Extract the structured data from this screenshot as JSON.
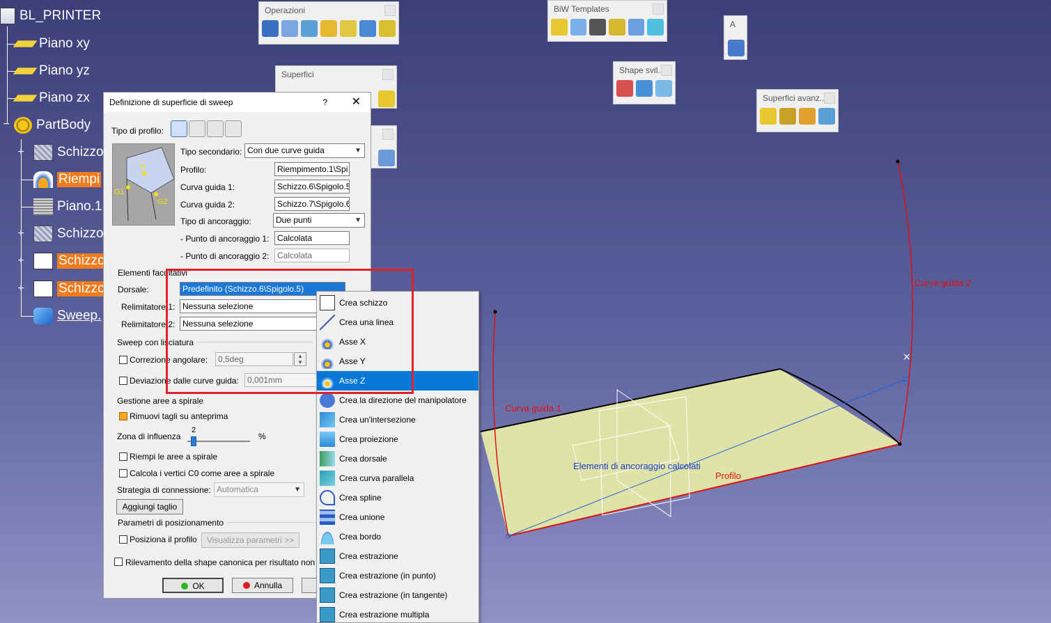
{
  "tree": {
    "root": "BL_PRINTER",
    "items": [
      {
        "label": "Piano xy"
      },
      {
        "label": "Piano yz"
      },
      {
        "label": "Piano zx"
      },
      {
        "label": "PartBody"
      },
      {
        "label": "Schizzo"
      },
      {
        "label": "Riempi"
      },
      {
        "label": "Piano.1"
      },
      {
        "label": "Schizzo"
      },
      {
        "label": "Schizzo"
      },
      {
        "label": "Schizzo"
      },
      {
        "label": "Sweep."
      }
    ]
  },
  "toolbars": {
    "operazioni": "Operazioni",
    "superfici": "Superfici",
    "biw": "BiW Templates",
    "shape": "Shape svil...",
    "avanzate": "Superfici avanz...",
    "small": "A"
  },
  "dialog": {
    "title": "Definizione di superficie di sweep",
    "help": "?",
    "tipo_profilo_label": "Tipo di profilo:",
    "tipo_secondario_label": "Tipo secondario:",
    "tipo_secondario_value": "Con due curve guida",
    "profilo_label": "Profilo:",
    "profilo_value": "Riempimento.1\\Spi",
    "guida1_label": "Curva guida 1:",
    "guida1_value": "Schizzo.6\\Spigolo.5",
    "guida2_label": "Curva guida 2:",
    "guida2_value": "Schizzo.7\\Spigolo.6",
    "ancoraggio_label": "Tipo di ancoraggio:",
    "ancoraggio_value": "Due punti",
    "punto1_label": "- Punto di ancoraggio 1:",
    "punto1_value": "Calcolata",
    "punto2_label": "- Punto di ancoraggio 2:",
    "punto2_value": "Calcolata",
    "preview_p": "P",
    "preview_g1": "G1",
    "preview_g2": "G2",
    "elementi_label": "Elementi facoltativi",
    "dorsale_label": "Dorsale:",
    "dorsale_value": "Predefinito (Schizzo.6\\Spigolo.5)",
    "rel1_label": "Relimitatore 1:",
    "rel1_value": "Nessuna selezione",
    "rel2_label": "Relimitatore 2:",
    "rel2_value": "Nessuna selezione",
    "sweep_lisc_label": "Sweep con lisciatura",
    "corr_ang_label": "Correzione angolare:",
    "corr_ang_value": "0,5deg",
    "dev_label": "Deviazione dalle curve guida:",
    "dev_value": "0,001mm",
    "spirale_label": "Gestione aree a spirale",
    "rimuovi_label": "Rimuovi tagli su anteprima",
    "zona_label": "Zona di influenza",
    "zona_value": "2",
    "zona_unit": "%",
    "riempi_label": "Riempi le aree a spirale",
    "calcola_label": "Calcola i vertici C0 come aree a spirale",
    "strategia_label": "Strategia di connessione:",
    "strategia_value": "Automatica",
    "aggiungi_label": "Aggiungi taglio",
    "param_label": "Parametri di posizionamento",
    "posiziona_label": "Posiziona il profilo",
    "visualizza_label": "Visualizza parametri >>",
    "rilevamento_label": "Rilevamento della shape canonica per risultato non c",
    "ok_label": "OK",
    "annulla_label": "Annulla"
  },
  "menu": {
    "items": [
      {
        "label": "Crea schizzo",
        "icon": "sketch-icon"
      },
      {
        "label": "Crea una linea",
        "icon": "line-icon"
      },
      {
        "label": "Asse X",
        "icon": "axis-x-icon"
      },
      {
        "label": "Asse Y",
        "icon": "axis-y-icon"
      },
      {
        "label": "Asse Z",
        "icon": "axis-z-icon"
      },
      {
        "label": "Crea la direzione del manipolatore",
        "icon": "manipulator-icon"
      },
      {
        "label": "Crea un'intersezione",
        "icon": "intersection-icon"
      },
      {
        "label": "Crea proiezione",
        "icon": "projection-icon"
      },
      {
        "label": "Crea dorsale",
        "icon": "spine-icon"
      },
      {
        "label": "Crea curva parallela",
        "icon": "parallel-curve-icon"
      },
      {
        "label": "Crea spline",
        "icon": "spline-icon"
      },
      {
        "label": "Crea unione",
        "icon": "join-icon"
      },
      {
        "label": "Crea bordo",
        "icon": "boundary-icon"
      },
      {
        "label": "Crea estrazione",
        "icon": "extract-icon"
      },
      {
        "label": "Crea estrazione (in punto)",
        "icon": "extract-point-icon"
      },
      {
        "label": "Crea estrazione (in tangente)",
        "icon": "extract-tangent-icon"
      },
      {
        "label": "Crea estrazione multipla",
        "icon": "multi-extract-icon"
      }
    ],
    "selected_index": 4
  },
  "viewport": {
    "guida2": "Curva guida 2",
    "guida1": "Curva guida 1",
    "ancoraggio": "Elementi di ancoraggio calcolati",
    "profilo": "Profilo"
  }
}
